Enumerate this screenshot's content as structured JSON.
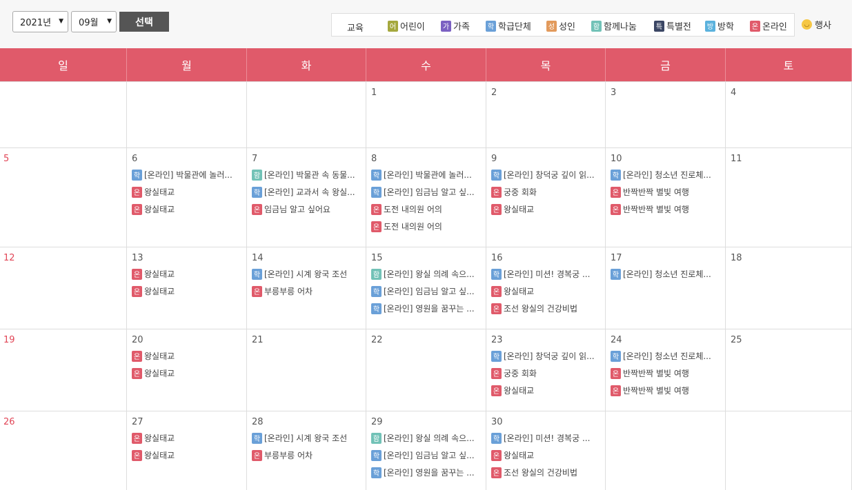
{
  "toolbar": {
    "year": "2021년",
    "month": "09월",
    "select_label": "선택"
  },
  "legend": {
    "label": "교육",
    "items": [
      {
        "badge": "어",
        "label": "어린이",
        "color": "#a5a83e"
      },
      {
        "badge": "가",
        "label": "가족",
        "color": "#7b61c2"
      },
      {
        "badge": "학",
        "label": "학급단체",
        "color": "#6aa0d8"
      },
      {
        "badge": "성",
        "label": "성인",
        "color": "#e29a5c"
      },
      {
        "badge": "함",
        "label": "함께나눔",
        "color": "#72c2b7"
      },
      {
        "badge": "특",
        "label": "특별전",
        "color": "#3b4664"
      },
      {
        "badge": "방",
        "label": "방학",
        "color": "#5bb2dd"
      },
      {
        "badge": "온",
        "label": "온라인",
        "color": "#e05a6a"
      }
    ],
    "event_label": "행사",
    "event_icon": "smiley-icon"
  },
  "weekdays": [
    "일",
    "월",
    "화",
    "수",
    "목",
    "금",
    "토"
  ],
  "colors": {
    "header_bg": "#e05a6a",
    "sunday": "#e14556"
  },
  "weeks": [
    {
      "days": [
        {
          "num": "",
          "events": []
        },
        {
          "num": "",
          "events": []
        },
        {
          "num": "",
          "events": []
        },
        {
          "num": "1",
          "events": []
        },
        {
          "num": "2",
          "events": []
        },
        {
          "num": "3",
          "events": []
        },
        {
          "num": "4",
          "events": []
        }
      ]
    },
    {
      "days": [
        {
          "num": "5",
          "events": []
        },
        {
          "num": "6",
          "events": [
            {
              "type": "학",
              "text": "[온라인] 박물관에 놀러..."
            },
            {
              "type": "온",
              "text": "왕실태교"
            },
            {
              "type": "온",
              "text": "왕실태교"
            }
          ]
        },
        {
          "num": "7",
          "events": [
            {
              "type": "함",
              "text": "[온라인] 박물관 속 동물..."
            },
            {
              "type": "학",
              "text": "[온라인] 교과서 속 왕실..."
            },
            {
              "type": "온",
              "text": "임금님 알고 싶어요"
            }
          ]
        },
        {
          "num": "8",
          "events": [
            {
              "type": "학",
              "text": "[온라인] 박물관에 놀러..."
            },
            {
              "type": "학",
              "text": "[온라인] 임금님 알고 싶..."
            },
            {
              "type": "온",
              "text": "도전 내의원 어의"
            },
            {
              "type": "온",
              "text": "도전 내의원 어의"
            }
          ]
        },
        {
          "num": "9",
          "events": [
            {
              "type": "학",
              "text": "[온라인] 창덕궁 깊이 읽..."
            },
            {
              "type": "온",
              "text": "궁중 회화"
            },
            {
              "type": "온",
              "text": "왕실태교"
            }
          ]
        },
        {
          "num": "10",
          "events": [
            {
              "type": "학",
              "text": "[온라인] 청소년 진로체..."
            },
            {
              "type": "온",
              "text": "반짝반짝 별빛 여행"
            },
            {
              "type": "온",
              "text": "반짝반짝 별빛 여행"
            }
          ]
        },
        {
          "num": "11",
          "events": []
        }
      ]
    },
    {
      "days": [
        {
          "num": "12",
          "events": []
        },
        {
          "num": "13",
          "events": [
            {
              "type": "온",
              "text": "왕실태교"
            },
            {
              "type": "온",
              "text": "왕실태교"
            }
          ]
        },
        {
          "num": "14",
          "events": [
            {
              "type": "학",
              "text": "[온라인] 시계 왕국 조선"
            },
            {
              "type": "온",
              "text": "부릉부릉 어차"
            }
          ]
        },
        {
          "num": "15",
          "events": [
            {
              "type": "함",
              "text": "[온라인] 왕실 의례 속으..."
            },
            {
              "type": "학",
              "text": "[온라인] 임금님 알고 싶..."
            },
            {
              "type": "학",
              "text": "[온라인] 영원을 꿈꾸는 ..."
            }
          ]
        },
        {
          "num": "16",
          "events": [
            {
              "type": "학",
              "text": "[온라인] 미션! 경복궁 ..."
            },
            {
              "type": "온",
              "text": "왕실태교"
            },
            {
              "type": "온",
              "text": "조선 왕실의 건강비법"
            }
          ]
        },
        {
          "num": "17",
          "events": [
            {
              "type": "학",
              "text": "[온라인] 청소년 진로체..."
            }
          ]
        },
        {
          "num": "18",
          "events": []
        }
      ]
    },
    {
      "days": [
        {
          "num": "19",
          "events": []
        },
        {
          "num": "20",
          "events": [
            {
              "type": "온",
              "text": "왕실태교"
            },
            {
              "type": "온",
              "text": "왕실태교"
            }
          ]
        },
        {
          "num": "21",
          "events": []
        },
        {
          "num": "22",
          "events": []
        },
        {
          "num": "23",
          "events": [
            {
              "type": "학",
              "text": "[온라인] 창덕궁 깊이 읽..."
            },
            {
              "type": "온",
              "text": "궁중 회화"
            },
            {
              "type": "온",
              "text": "왕실태교"
            }
          ]
        },
        {
          "num": "24",
          "events": [
            {
              "type": "학",
              "text": "[온라인] 청소년 진로체..."
            },
            {
              "type": "온",
              "text": "반짝반짝 별빛 여행"
            },
            {
              "type": "온",
              "text": "반짝반짝 별빛 여행"
            }
          ]
        },
        {
          "num": "25",
          "events": []
        }
      ]
    },
    {
      "days": [
        {
          "num": "26",
          "events": []
        },
        {
          "num": "27",
          "events": [
            {
              "type": "온",
              "text": "왕실태교"
            },
            {
              "type": "온",
              "text": "왕실태교"
            }
          ]
        },
        {
          "num": "28",
          "events": [
            {
              "type": "학",
              "text": "[온라인] 시계 왕국 조선"
            },
            {
              "type": "온",
              "text": "부릉부릉 어차"
            }
          ]
        },
        {
          "num": "29",
          "events": [
            {
              "type": "함",
              "text": "[온라인] 왕실 의례 속으..."
            },
            {
              "type": "학",
              "text": "[온라인] 임금님 알고 싶..."
            },
            {
              "type": "학",
              "text": "[온라인] 영원을 꿈꾸는 ..."
            }
          ]
        },
        {
          "num": "30",
          "events": [
            {
              "type": "학",
              "text": "[온라인] 미션! 경복궁 ..."
            },
            {
              "type": "온",
              "text": "왕실태교"
            },
            {
              "type": "온",
              "text": "조선 왕실의 건강비법"
            }
          ]
        },
        {
          "num": "",
          "events": []
        },
        {
          "num": "",
          "events": []
        }
      ]
    }
  ]
}
